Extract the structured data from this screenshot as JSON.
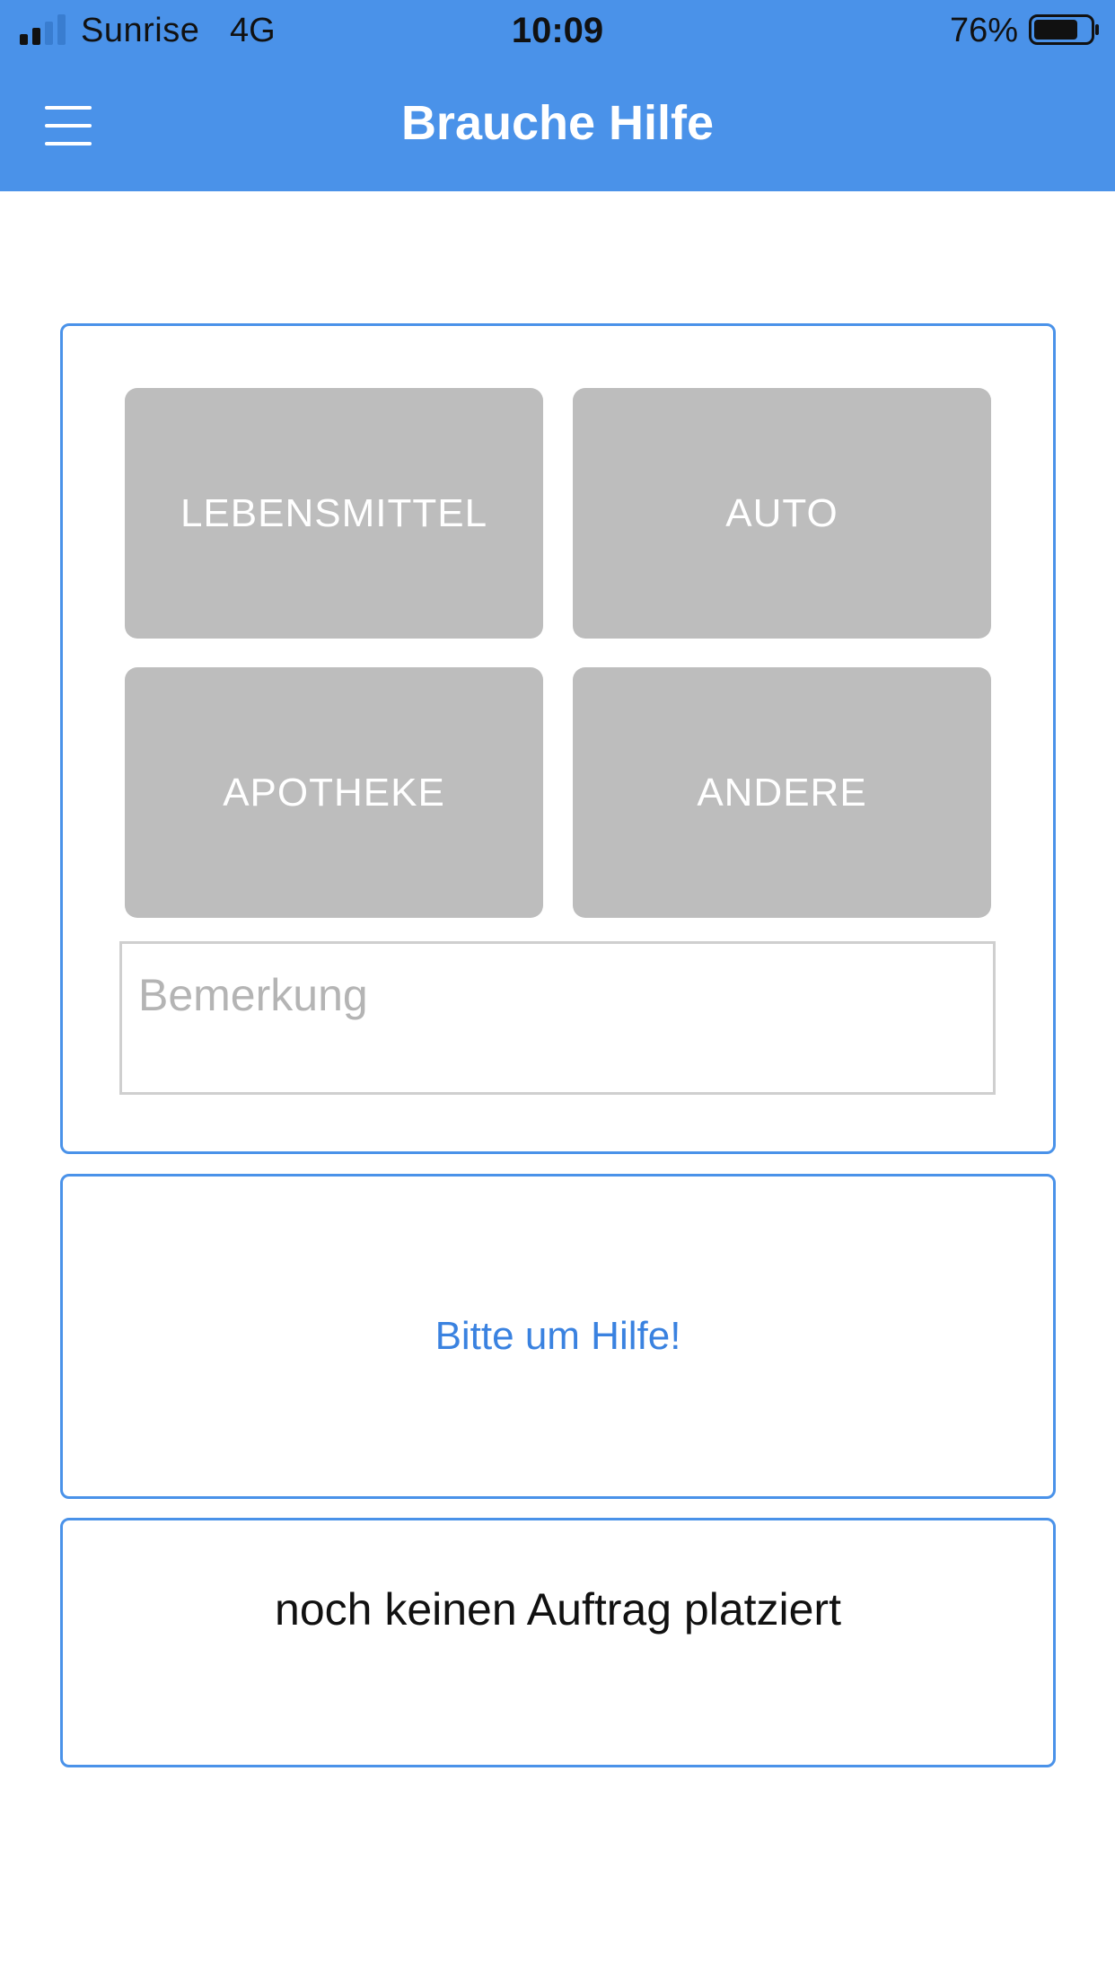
{
  "status_bar": {
    "carrier": "Sunrise",
    "network": "4G",
    "time": "10:09",
    "battery_percent": "76%",
    "battery_level": 0.76,
    "signal_bars": 2
  },
  "nav": {
    "title": "Brauche Hilfe",
    "menu_icon": "hamburger-menu-icon",
    "background_color": "#4a92e9"
  },
  "categories": [
    {
      "label": "LEBENSMITTEL"
    },
    {
      "label": "AUTO"
    },
    {
      "label": "APOTHEKE"
    },
    {
      "label": "ANDERE"
    }
  ],
  "remark_field": {
    "value": "",
    "placeholder": "Bemerkung"
  },
  "request_button": {
    "label": "Bitte um Hilfe!"
  },
  "order_status": {
    "text": "noch keinen Auftrag platziert"
  },
  "colors": {
    "accent": "#4a92e9",
    "link": "#3a82e0",
    "category_bg": "#bdbdbd"
  }
}
